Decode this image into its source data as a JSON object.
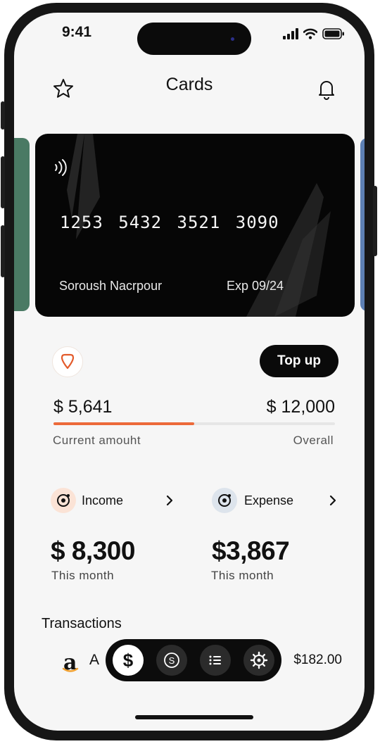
{
  "status_bar": {
    "time": "9:41"
  },
  "header": {
    "title": "Cards",
    "left_icon": "star-icon",
    "right_icon": "bell-icon"
  },
  "card": {
    "number": "1253 5432 3521 3090",
    "holder": "Soroush Nacrpour",
    "expiry": "Exp 09/24",
    "contactless_icon": "contactless-icon"
  },
  "balance": {
    "icon": "location-pin-icon",
    "top_up_label": "Top up",
    "current_amount": "$ 5,641",
    "current_label": "Current amouht",
    "overall_amount": "$ 12,000",
    "overall_label": "Overall",
    "progress_fraction": 0.5,
    "accent_color": "#ec6a3a"
  },
  "income": {
    "label": "Income",
    "amount": "$ 8,300",
    "period": "This month",
    "icon_bg": "#fbe3d6",
    "icon": "chart-ring-icon"
  },
  "expense": {
    "label": "Expense",
    "amount": "$3,867",
    "period": "This month",
    "icon_bg": "#dde4ec",
    "icon": "chart-ring-icon"
  },
  "transactions": {
    "title": "Transactions",
    "items": [
      {
        "logo_text": "a",
        "initial": "A",
        "amount": "$182.00"
      }
    ]
  },
  "tabbar": {
    "active_label": "$",
    "tabs": [
      "dollar-icon",
      "coin-icon",
      "list-icon",
      "settings-icon"
    ]
  }
}
